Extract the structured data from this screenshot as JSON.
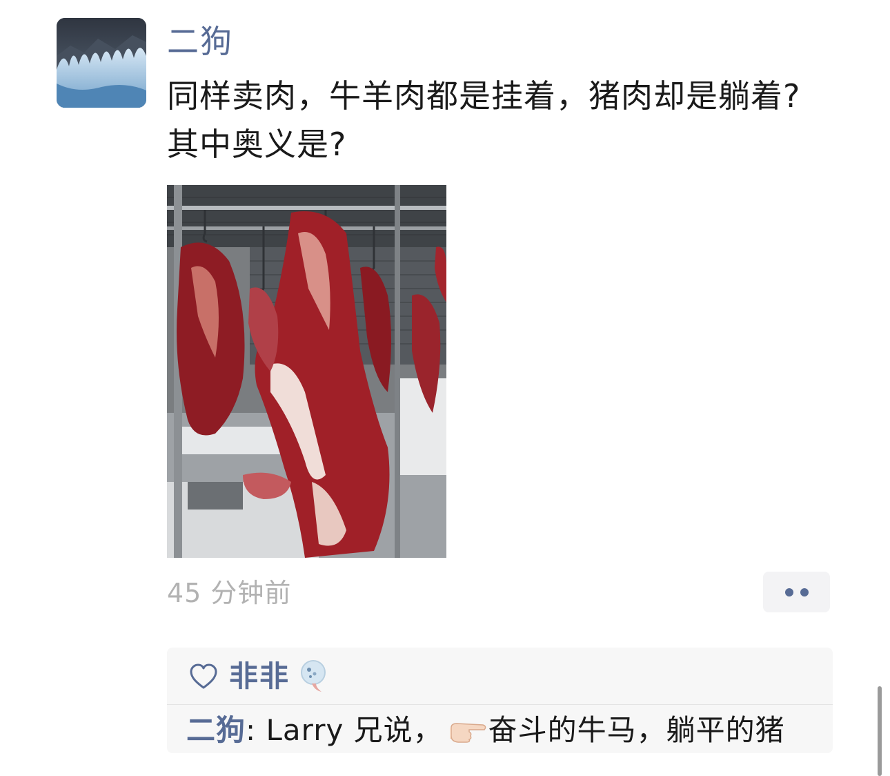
{
  "post": {
    "author": "二狗",
    "text": "同样卖肉，牛羊肉都是挂着，猪肉却是躺着?其中奥义是?",
    "timestamp": "45 分钟前"
  },
  "icons": {
    "avatar": "ice-forest-avatar",
    "more": "more-dots-icon",
    "like": "heart-outline-icon",
    "liker_avatar": "small-avatar-icon",
    "pointing": "pointing-right-hand-emoji"
  },
  "interactions": {
    "likes": [
      "非非"
    ],
    "comments": [
      {
        "author": "二狗",
        "separator": ": ",
        "text_before": "Larry 兄说，",
        "text_after": "奋斗的牛马，躺平的猪"
      }
    ]
  },
  "colors": {
    "link": "#576b95",
    "text": "#1a1a1a",
    "muted": "#b2b2b2",
    "panel": "#f7f7f7"
  }
}
